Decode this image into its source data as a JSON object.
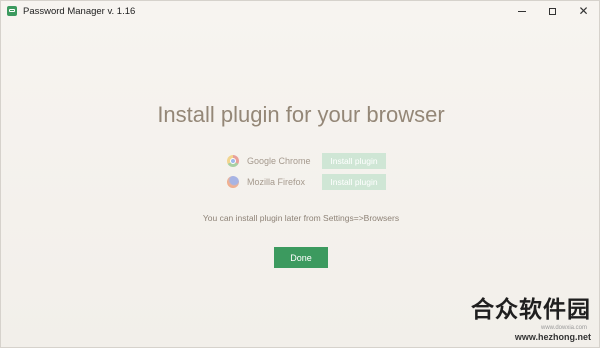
{
  "window": {
    "title": "Password Manager v. 1.16",
    "controls": {
      "minimize_icon": "minimize-icon",
      "maximize_icon": "maximize-icon",
      "close_icon": "close-icon",
      "close_glyph": "✕"
    }
  },
  "main": {
    "heading": "Install plugin for your browser",
    "browsers": [
      {
        "name": "Google Chrome",
        "icon": "chrome-icon",
        "button_label": "Install plugin"
      },
      {
        "name": "Mozilla Firefox",
        "icon": "firefox-icon",
        "button_label": "Install plugin"
      }
    ],
    "note": "You can install plugin later from Settings=>Browsers",
    "done_label": "Done"
  },
  "watermark": {
    "brand": "合众软件园",
    "url_small": "www.dowxia.com",
    "url": "www.hezhong.net"
  },
  "colors": {
    "accent": "#3c9a5f",
    "install_button": "#cfe6d5",
    "heading_text": "#948777",
    "background": "#f4f1ec"
  }
}
